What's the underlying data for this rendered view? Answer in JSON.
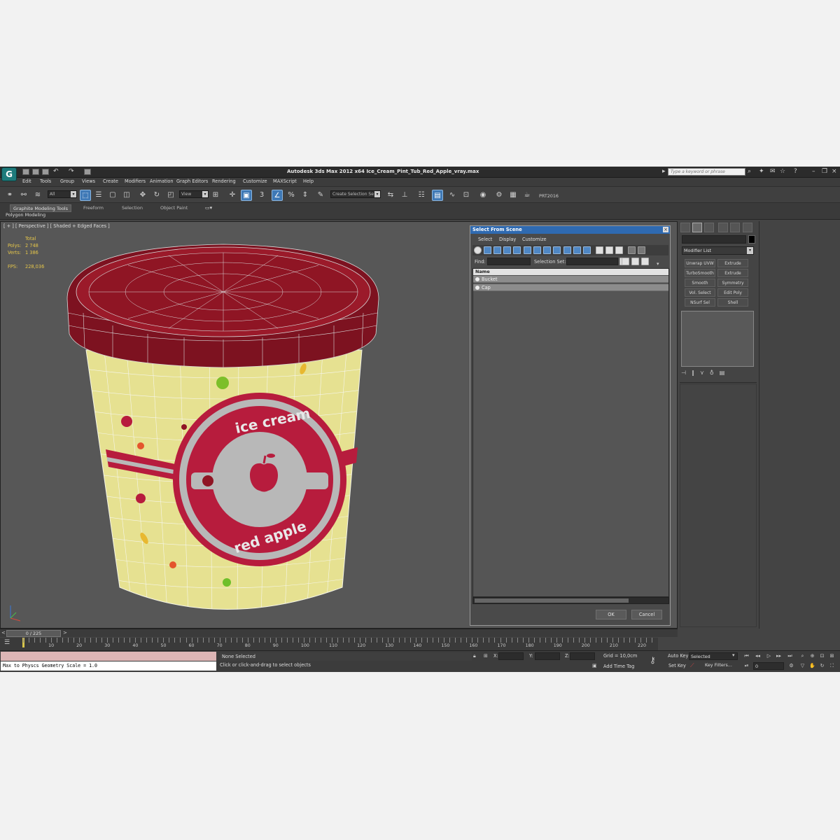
{
  "app": {
    "title": "Autodesk 3ds Max  2012 x64     Ice_Cream_Pint_Tub_Red_Apple_vray.max",
    "logo_glyph": "G",
    "search_placeholder": "Type a keyword or phrase"
  },
  "menu": [
    "Edit",
    "Tools",
    "Group",
    "Views",
    "Create",
    "Modifiers",
    "Animation",
    "Graph Editors",
    "Rendering",
    "Customize",
    "MAXScript",
    "Help"
  ],
  "toolbar": {
    "filter_value": "All",
    "refcoord_value": "View",
    "named_selection": "Create Selection Se",
    "snap_label": "3",
    "render_label": "PRT2016"
  },
  "ribbon": {
    "tabs": [
      "Graphite Modeling Tools",
      "Freeform",
      "Selection",
      "Object Paint"
    ],
    "sublabel": "Polygon Modeling"
  },
  "viewport": {
    "label": "[ + ] [ Perspective ] [ Shaded + Edged Faces ]",
    "stats": {
      "total_label": "Total",
      "polys_label": "Polys:",
      "polys_value": "2 748",
      "verts_label": "Verts:",
      "verts_value": "1 386",
      "fps_label": "FPS:",
      "fps_value": "228,036"
    },
    "label_top": "ice cream",
    "label_bottom": "red apple",
    "colors": {
      "lid": "#8f1524",
      "tub": "#e8e391",
      "seal": "#b71c3d",
      "background": "#575757"
    }
  },
  "dialog": {
    "title": "Select From Scene",
    "menu": [
      "Select",
      "Display",
      "Customize"
    ],
    "find_label": "Find:",
    "selection_set_label": "Selection Set:",
    "column_name": "Name",
    "rows": [
      "Bucket",
      "Cap"
    ],
    "ok": "OK",
    "cancel": "Cancel"
  },
  "command_panel": {
    "modifier_list": "Modifier List",
    "modifier_buttons": [
      "Unwrap UVW",
      "Extrude",
      "TurboSmooth",
      "Extrude",
      "Smooth",
      "Symmetry",
      "Vol. Select",
      "Edit Poly",
      "NSurf Sel",
      "Shell"
    ]
  },
  "timeline": {
    "frame_display": "0 / 225",
    "ticks": [
      "10",
      "20",
      "30",
      "40",
      "50",
      "60",
      "70",
      "80",
      "90",
      "100",
      "110",
      "120",
      "130",
      "140",
      "150",
      "160",
      "170",
      "180",
      "190",
      "200",
      "210",
      "220"
    ]
  },
  "status": {
    "maxscript_output": "Max to Physcs Geometry Scale = 1.0",
    "selection": "None Selected",
    "prompt": "Click or click-and-drag to select objects",
    "x_label": "X:",
    "y_label": "Y:",
    "z_label": "Z:",
    "grid": "Grid = 10,0cm",
    "add_time_tag": "Add Time Tag",
    "auto_key": "Auto Key",
    "set_key": "Set Key",
    "selected_dropdown": "Selected",
    "key_filters": "Key Filters...",
    "current_frame": "0"
  }
}
